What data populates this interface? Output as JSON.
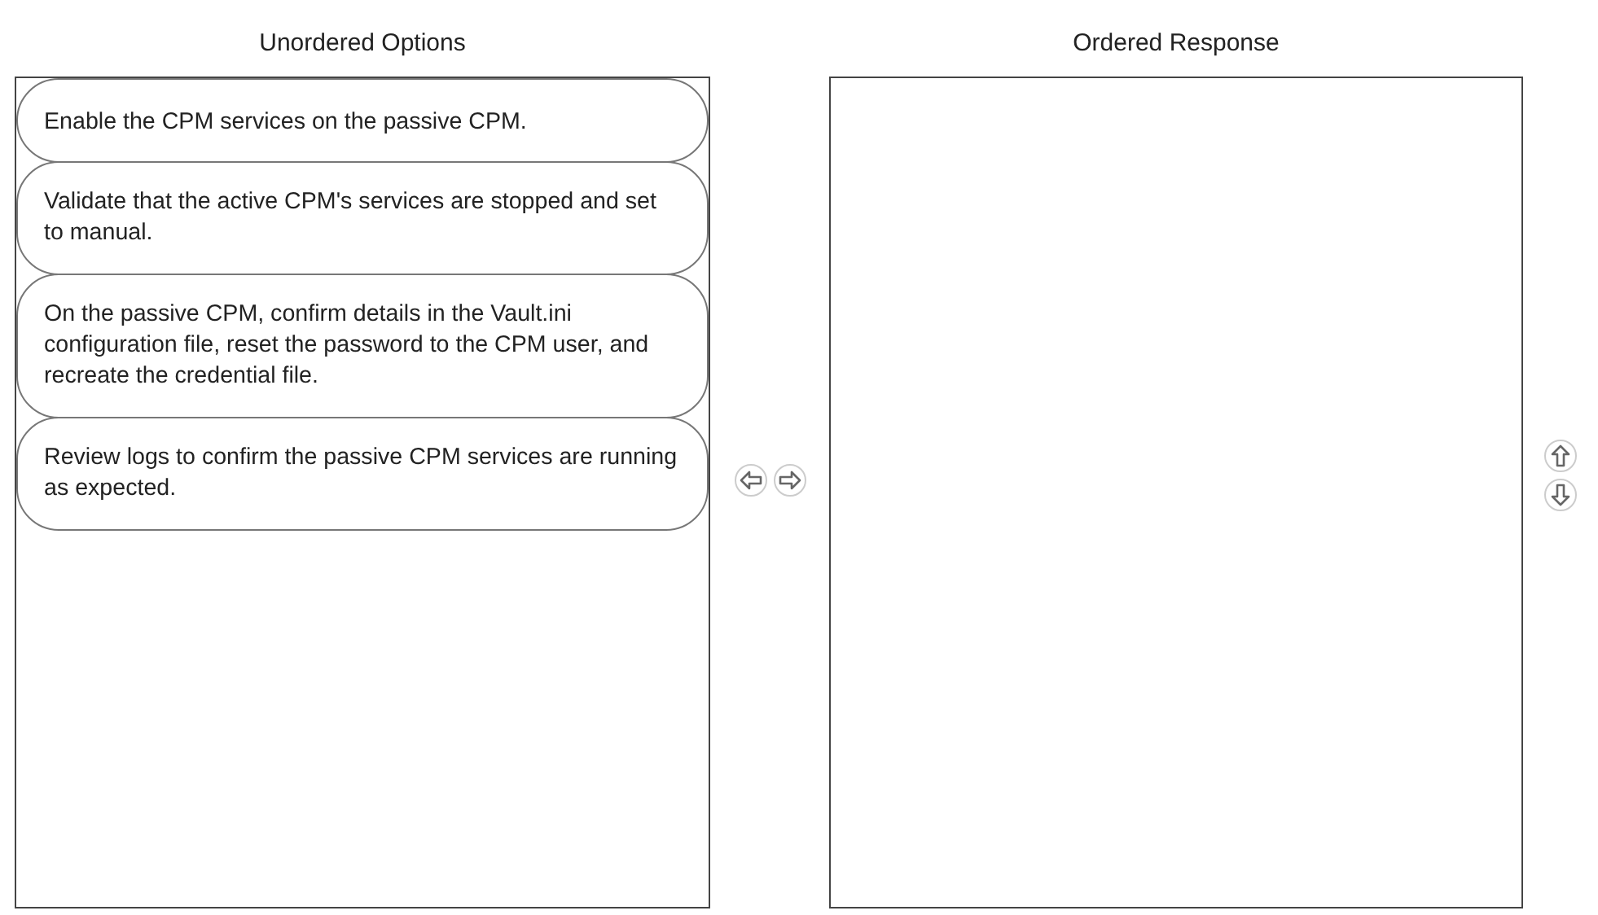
{
  "unordered": {
    "heading": "Unordered Options",
    "options": [
      {
        "text": "Enable the CPM services on the passive CPM."
      },
      {
        "text": "Validate that the active CPM's services are stopped and set to manual."
      },
      {
        "text": "On the passive CPM, confirm details in the Vault.ini configuration file, reset the password to the CPM user, and recreate the credential file."
      },
      {
        "text": "Review logs to confirm the passive CPM services are running as expected."
      }
    ]
  },
  "ordered": {
    "heading": "Ordered Response"
  }
}
